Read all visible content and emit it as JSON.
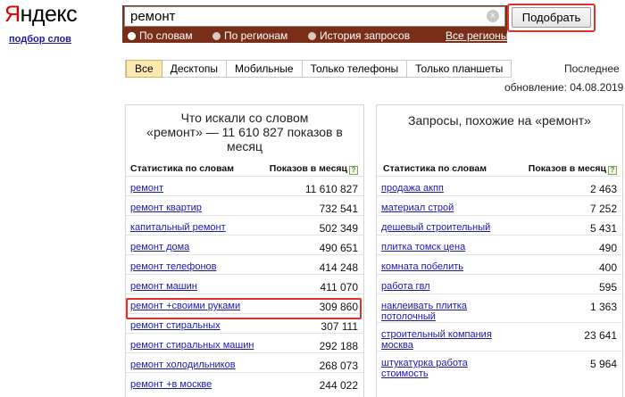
{
  "logo": {
    "first_letter": "Я",
    "rest": "ндекс"
  },
  "sublink": "подбор слов",
  "search": {
    "value": "ремонт",
    "clear_icon": "×"
  },
  "search_modes": [
    {
      "label": "По словам",
      "selected": true
    },
    {
      "label": "По регионам",
      "selected": false
    },
    {
      "label": "История запросов",
      "selected": false
    }
  ],
  "all_regions": "Все регионы",
  "submit_label": "Подобрать",
  "tabs": [
    "Все",
    "Десктопы",
    "Мобильные",
    "Только телефоны",
    "Только планшеты"
  ],
  "updated": {
    "line1": "Последнее",
    "line2": "обновление: 04.08.2019"
  },
  "left": {
    "title_line1": "Что искали со словом",
    "title_line2": "«ремонт» — 11 610 827 показов в",
    "title_line3": "месяц",
    "col_keyword": "Статистика по словам",
    "col_count": "Показов в месяц",
    "rows": [
      {
        "kw": "ремонт",
        "count": "11 610 827"
      },
      {
        "kw": "ремонт квартир",
        "count": "732 541"
      },
      {
        "kw": "капитальный ремонт",
        "count": "502 349"
      },
      {
        "kw": "ремонт дома",
        "count": "490 651"
      },
      {
        "kw": "ремонт телефонов",
        "count": "414 248"
      },
      {
        "kw": "ремонт машин",
        "count": "411 070"
      },
      {
        "kw": "ремонт +своими руками",
        "count": "309 860"
      },
      {
        "kw": "ремонт стиральных",
        "count": "307 111"
      },
      {
        "kw": "ремонт стиральных машин",
        "count": "292 188"
      },
      {
        "kw": "ремонт холодильников",
        "count": "268 073"
      },
      {
        "kw": "ремонт +в москве",
        "count": "244 022"
      }
    ]
  },
  "right": {
    "title": "Запросы, похожие на «ремонт»",
    "col_keyword": "Статистика по словам",
    "col_count": "Показов в месяц",
    "rows": [
      {
        "kw": "продажа акпп",
        "count": "2 463"
      },
      {
        "kw": "материал строй",
        "count": "7 252"
      },
      {
        "kw": "дешевый строительный",
        "count": "5 431"
      },
      {
        "kw": "плитка томск цена",
        "count": "490"
      },
      {
        "kw": "комната побелить",
        "count": "400"
      },
      {
        "kw": "работа гвл",
        "count": "595"
      },
      {
        "kw": "наклеивать плитка потолочный",
        "count": "1 363"
      },
      {
        "kw": "строительный компания москва",
        "count": "23 641"
      },
      {
        "kw": "штукатурка работа стоимость",
        "count": "5 964"
      }
    ]
  }
}
